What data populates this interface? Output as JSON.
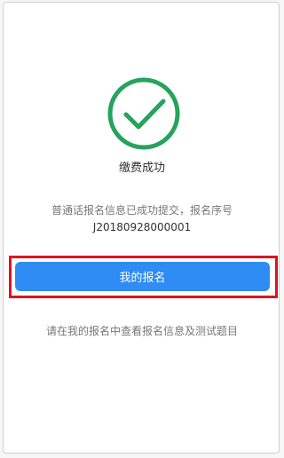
{
  "colors": {
    "success_green": "#27a35c",
    "primary_blue": "#2f8cf4",
    "highlight_red": "#e3101e"
  },
  "status": {
    "icon": "check-circle-icon",
    "title": "缴费成功"
  },
  "message": {
    "text": "普通话报名信息已成功提交，报名序号",
    "order_number": "J20180928000001"
  },
  "actions": {
    "my_registration_label": "我的报名"
  },
  "hint": {
    "text": "请在我的报名中查看报名信息及测试题目"
  }
}
